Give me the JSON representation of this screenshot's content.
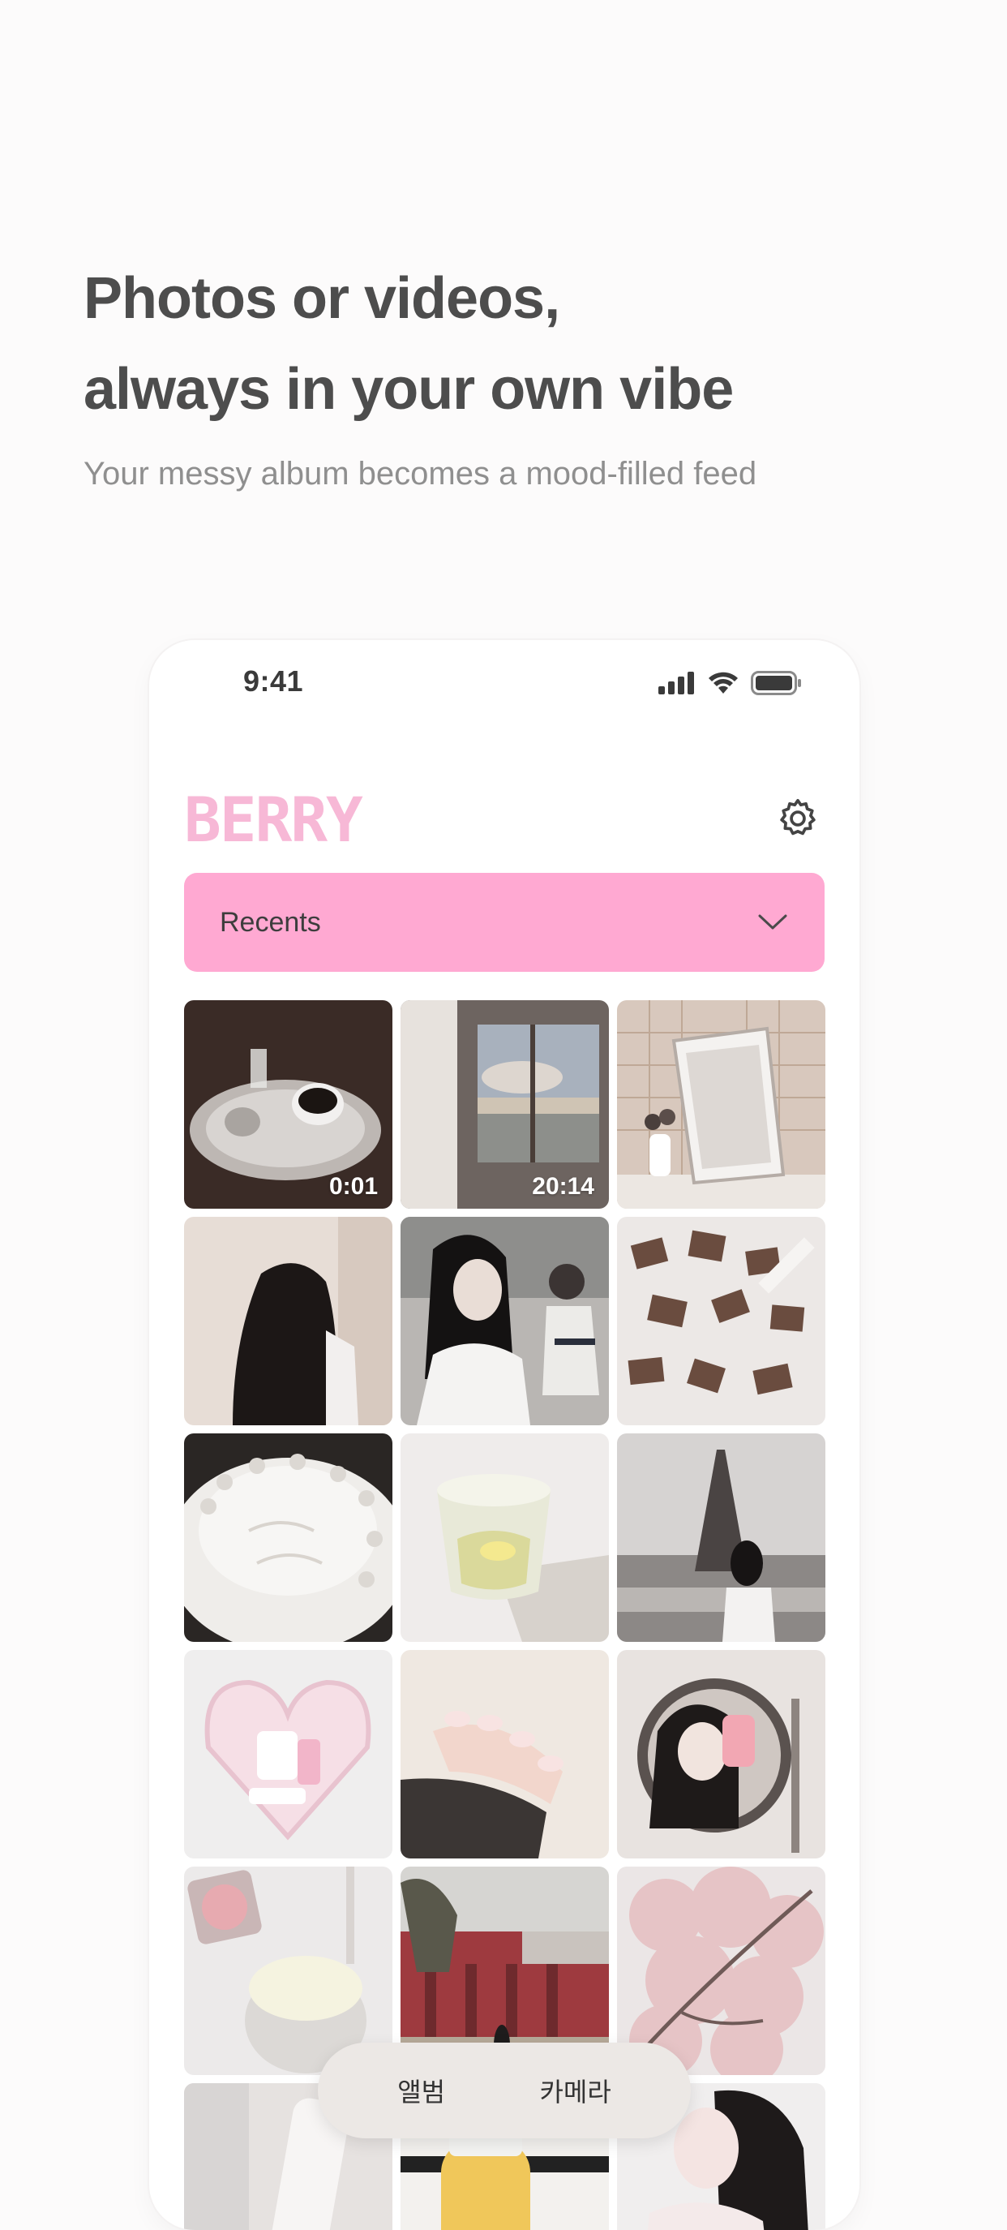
{
  "hero": {
    "headline_line1": "Photos or videos,",
    "headline_line2": "always in your own vibe",
    "subtitle": "Your messy album becomes a mood-filled feed"
  },
  "status_bar": {
    "time": "9:41",
    "icons": [
      "signal-icon",
      "wifi-icon",
      "battery-icon"
    ]
  },
  "app": {
    "logo_text": "BERRY",
    "settings_icon": "gear-icon",
    "album_selector": {
      "selected": "Recents",
      "icon": "chevron-down-icon"
    }
  },
  "grid": {
    "items": [
      {
        "label": "coffee-on-tray",
        "duration": "0:01"
      },
      {
        "label": "window-seaside",
        "duration": "20:14"
      },
      {
        "label": "mirror-flowers",
        "duration": ""
      },
      {
        "label": "long-hair-back",
        "duration": ""
      },
      {
        "label": "street-portrait",
        "duration": ""
      },
      {
        "label": "chocolate-pieces",
        "duration": ""
      },
      {
        "label": "white-cake",
        "duration": ""
      },
      {
        "label": "lemon-water",
        "duration": ""
      },
      {
        "label": "eiffel-tower",
        "duration": ""
      },
      {
        "label": "heart-pouch",
        "duration": ""
      },
      {
        "label": "pink-nails",
        "duration": ""
      },
      {
        "label": "mirror-selfie",
        "duration": ""
      },
      {
        "label": "ice-cream-cup",
        "duration": ""
      },
      {
        "label": "red-building",
        "duration": ""
      },
      {
        "label": "cherry-blossoms",
        "duration": ""
      },
      {
        "label": "cream-tube",
        "duration": ""
      },
      {
        "label": "yellow-drink",
        "duration": ""
      },
      {
        "label": "pink-portrait",
        "duration": ""
      }
    ]
  },
  "bottom_tabs": {
    "album": "앨범",
    "camera": "카메라"
  },
  "colors": {
    "accent_pink": "#ffa9d2",
    "logo_pink": "#f7b8d6",
    "headline": "#4d4d4d",
    "subtitle": "#8f8f8f"
  }
}
